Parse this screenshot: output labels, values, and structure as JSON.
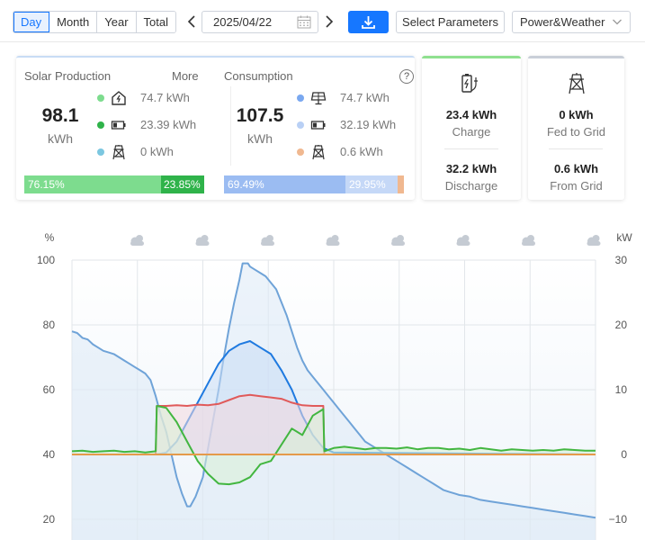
{
  "toolbar": {
    "tabs": [
      "Day",
      "Month",
      "Year",
      "Total"
    ],
    "active_tab": "Day",
    "prev_label": "<",
    "next_label": ">",
    "date": "2025/04/22",
    "params_label": "Select Parameters",
    "view_select": "Power&Weather",
    "accent": "#1677ff"
  },
  "solar": {
    "title": "Solar Production",
    "more": "More",
    "total": "98.1",
    "unit": "kWh",
    "items": [
      {
        "icon": "home-icon",
        "value": "74.7 kWh",
        "color": "#7ddc8e"
      },
      {
        "icon": "battery-icon",
        "value": "23.39 kWh",
        "color": "#2fb34a"
      },
      {
        "icon": "grid-tower-icon",
        "value": "0 kWh",
        "color": "#7cc7e0"
      }
    ],
    "bar": [
      {
        "label": "76.15%",
        "share": 76.15,
        "color": "#7ddc8e"
      },
      {
        "label": "23.85%",
        "share": 23.85,
        "color": "#2fb34a"
      }
    ]
  },
  "consumption": {
    "title": "Consumption",
    "help": "?",
    "total": "107.5",
    "unit": "kWh",
    "items": [
      {
        "icon": "solar-panel-icon",
        "value": "74.7 kWh",
        "color": "#7aa8f0"
      },
      {
        "icon": "battery-icon",
        "value": "32.19 kWh",
        "color": "#b9d0f5"
      },
      {
        "icon": "grid-tower-icon",
        "value": "0.6 kWh",
        "color": "#f0b890"
      }
    ],
    "bar": [
      {
        "label": "69.49%",
        "share": 69.49,
        "color": "#9bbcf2"
      },
      {
        "label": "29.95%",
        "share": 29.95,
        "color": "#c5d8f7"
      },
      {
        "label": "",
        "share": 0.56,
        "color": "#f0b890"
      }
    ]
  },
  "battery": {
    "icon": "battery-charge-icon",
    "charge_value": "23.4 kWh",
    "charge_label": "Charge",
    "discharge_value": "32.2 kWh",
    "discharge_label": "Discharge"
  },
  "grid": {
    "icon": "grid-tower-icon",
    "fed_value": "0 kWh",
    "fed_label": "Fed to Grid",
    "from_value": "0.6 kWh",
    "from_label": "From Grid"
  },
  "chart_data": {
    "type": "line",
    "left_axis_label": "%",
    "right_axis_label": "kW",
    "left_ylim": [
      20,
      100
    ],
    "right_ylim": [
      -10,
      30
    ],
    "left_ticks": [
      100,
      80,
      60,
      40,
      20
    ],
    "right_ticks": [
      30,
      20,
      10,
      0,
      -10
    ],
    "grid": true,
    "weather_icons": [
      "cloudy-icon",
      "cloudy-icon",
      "cloudy-icon",
      "cloudy-icon",
      "cloudy-icon",
      "cloudy-icon",
      "cloudy-icon",
      "cloudy-icon"
    ],
    "series": [
      {
        "axis": "left",
        "color": "#6fa3d8",
        "fill": "#dce9f6",
        "values": [
          [
            0,
            78
          ],
          [
            0.5,
            77.5
          ],
          [
            1,
            76
          ],
          [
            1.5,
            75.5
          ],
          [
            2,
            74
          ],
          [
            2.5,
            73
          ],
          [
            3,
            72
          ],
          [
            3.5,
            71.5
          ],
          [
            4,
            71
          ],
          [
            4.5,
            70
          ],
          [
            5,
            69
          ],
          [
            5.5,
            68
          ],
          [
            6,
            67
          ],
          [
            6.5,
            66
          ],
          [
            7,
            65
          ],
          [
            7.5,
            63
          ],
          [
            8,
            58
          ],
          [
            8.5,
            52
          ],
          [
            9,
            47
          ],
          [
            9.5,
            40
          ],
          [
            10,
            33
          ],
          [
            10.5,
            28
          ],
          [
            11,
            24
          ],
          [
            11.3,
            24
          ],
          [
            11.8,
            27
          ],
          [
            12.5,
            33
          ],
          [
            13,
            42
          ],
          [
            13.5,
            51
          ],
          [
            14,
            60
          ],
          [
            14.5,
            70
          ],
          [
            15,
            79
          ],
          [
            15.5,
            87
          ],
          [
            16,
            94
          ],
          [
            16.3,
            99
          ],
          [
            16.8,
            99
          ],
          [
            17,
            98
          ],
          [
            17.5,
            97
          ],
          [
            18,
            96
          ],
          [
            18.5,
            95
          ],
          [
            19,
            93
          ],
          [
            19.5,
            91
          ],
          [
            20,
            87
          ],
          [
            20.5,
            83
          ],
          [
            21,
            78
          ],
          [
            21.5,
            73
          ],
          [
            22,
            69
          ],
          [
            22.5,
            66
          ],
          [
            23,
            64
          ],
          [
            23.5,
            62
          ],
          [
            24,
            60
          ],
          [
            24.5,
            58
          ],
          [
            25,
            56
          ],
          [
            25.5,
            54
          ],
          [
            26,
            52
          ],
          [
            26.5,
            50
          ],
          [
            27,
            48
          ],
          [
            27.5,
            46
          ],
          [
            28,
            44
          ],
          [
            28.5,
            43
          ],
          [
            29,
            42
          ],
          [
            29.5,
            41
          ],
          [
            30,
            40
          ],
          [
            30.5,
            39
          ],
          [
            31,
            38
          ],
          [
            31.5,
            37
          ],
          [
            32,
            36
          ],
          [
            32.5,
            35
          ],
          [
            33,
            34
          ],
          [
            33.5,
            33
          ],
          [
            34,
            32
          ],
          [
            34.5,
            31
          ],
          [
            35,
            30
          ],
          [
            35.5,
            29
          ],
          [
            36,
            28.5
          ],
          [
            36.5,
            28
          ],
          [
            37,
            27.5
          ],
          [
            38,
            27
          ],
          [
            39,
            26
          ],
          [
            40,
            25.5
          ],
          [
            41,
            25
          ],
          [
            42,
            24.5
          ],
          [
            43,
            24
          ],
          [
            44,
            23.5
          ],
          [
            45,
            23
          ],
          [
            46,
            22.5
          ],
          [
            47,
            22
          ],
          [
            48,
            21.5
          ],
          [
            49,
            21
          ],
          [
            50,
            20.5
          ]
        ]
      },
      {
        "axis": "right",
        "color": "#1f7ae0",
        "fill": "#c9dcf6",
        "values": [
          [
            0,
            0
          ],
          [
            8,
            0
          ],
          [
            9,
            0.3
          ],
          [
            10,
            2
          ],
          [
            11,
            5
          ],
          [
            12,
            8
          ],
          [
            13,
            11
          ],
          [
            14,
            14
          ],
          [
            15,
            16
          ],
          [
            16,
            17
          ],
          [
            17,
            17.5
          ],
          [
            18,
            16.5
          ],
          [
            19,
            15.5
          ],
          [
            20,
            13
          ],
          [
            21,
            10
          ],
          [
            22,
            6
          ],
          [
            23,
            3
          ],
          [
            24,
            1
          ],
          [
            25,
            0.3
          ],
          [
            50,
            0
          ]
        ]
      },
      {
        "axis": "right",
        "color": "#e05a5a",
        "fill": "#f2d9de",
        "values": [
          [
            0,
            0
          ],
          [
            8,
            0
          ],
          [
            8.1,
            7.5
          ],
          [
            9,
            7.5
          ],
          [
            10,
            7.6
          ],
          [
            11,
            7.5
          ],
          [
            12,
            7.7
          ],
          [
            13,
            7.6
          ],
          [
            14,
            7.8
          ],
          [
            15,
            8.4
          ],
          [
            16,
            9.0
          ],
          [
            17,
            9.2
          ],
          [
            18,
            9.0
          ],
          [
            19,
            8.8
          ],
          [
            20,
            8.6
          ],
          [
            21,
            8.0
          ],
          [
            22,
            7.6
          ],
          [
            23,
            7.5
          ],
          [
            24,
            7.5
          ],
          [
            24.1,
            0
          ],
          [
            50,
            0
          ]
        ]
      },
      {
        "axis": "right",
        "color": "#42b640",
        "fill": "#d8f1d6",
        "values": [
          [
            0,
            0.5
          ],
          [
            1,
            0.6
          ],
          [
            2,
            0.4
          ],
          [
            3,
            0.5
          ],
          [
            4,
            0.6
          ],
          [
            5,
            0.4
          ],
          [
            6,
            0.5
          ],
          [
            7,
            0.3
          ],
          [
            8,
            0.5
          ],
          [
            8.1,
            7.5
          ],
          [
            9,
            7.2
          ],
          [
            10,
            5
          ],
          [
            11,
            2
          ],
          [
            12,
            -1
          ],
          [
            13,
            -3
          ],
          [
            14,
            -4.5
          ],
          [
            15,
            -4.6
          ],
          [
            16,
            -4.3
          ],
          [
            17,
            -3.5
          ],
          [
            18,
            -1.5
          ],
          [
            19,
            -1
          ],
          [
            20,
            1.5
          ],
          [
            21,
            4
          ],
          [
            22,
            3
          ],
          [
            23,
            6
          ],
          [
            24,
            7
          ],
          [
            24.1,
            0.5
          ],
          [
            25,
            1
          ],
          [
            26,
            1.2
          ],
          [
            27,
            1
          ],
          [
            28,
            0.8
          ],
          [
            29,
            1
          ],
          [
            30,
            1
          ],
          [
            31,
            0.9
          ],
          [
            32,
            1.1
          ],
          [
            33,
            0.8
          ],
          [
            34,
            1
          ],
          [
            35,
            1
          ],
          [
            36,
            0.8
          ],
          [
            37,
            0.9
          ],
          [
            38,
            0.7
          ],
          [
            39,
            1
          ],
          [
            40,
            0.8
          ],
          [
            41,
            0.6
          ],
          [
            42,
            0.8
          ],
          [
            43,
            0.7
          ],
          [
            44,
            0.6
          ],
          [
            45,
            0.7
          ],
          [
            46,
            0.6
          ],
          [
            47,
            0.8
          ],
          [
            48,
            0.7
          ],
          [
            49,
            0.6
          ],
          [
            50,
            0.6
          ]
        ]
      },
      {
        "axis": "right",
        "color": "#e59a4a",
        "fill": "none",
        "values": [
          [
            0,
            0
          ],
          [
            50,
            0
          ]
        ]
      }
    ]
  }
}
